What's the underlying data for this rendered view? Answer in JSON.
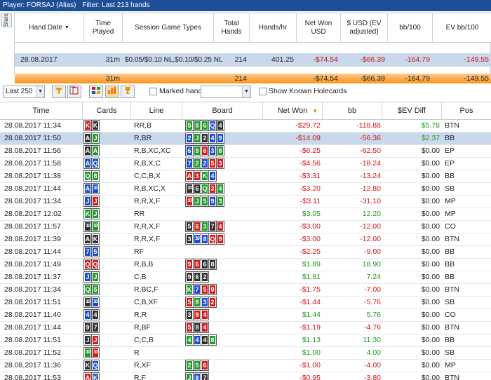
{
  "titlebar": {
    "player": "Player: FORSAJ (Alias)",
    "filter": "Filter: Last 213 hands"
  },
  "stats_tab": "Stats",
  "sessions": {
    "headers": [
      "Hand Date",
      "Time Played",
      "Session Game Types",
      "Total Hands",
      "Hands/hr",
      "Net Won USD",
      "$ USD (EV adjusted)",
      "bb/100",
      "EV bb/100"
    ],
    "row": {
      "date": "28.08.2017",
      "time": "31m",
      "games": "$0.05/$0.10 NL,$0.10/$0.25 NL",
      "hands": "214",
      "hph": "401.25",
      "net": "-$74.54",
      "ev": "-$66.39",
      "bb100": "-164.79",
      "evbb": "-149.55"
    },
    "total": {
      "time": "31m",
      "hands": "214",
      "net": "-$74.54",
      "ev": "-$66.39",
      "bb100": "-164.79",
      "evbb": "-149.55"
    }
  },
  "toolbar": {
    "limit": "Last 250",
    "marked": "Marked hands",
    "known": "Show Known Holecards"
  },
  "columns": [
    "Time",
    "Cards",
    "Line",
    "Board",
    "Net Won",
    "bb",
    "$EV Diff",
    "Pos"
  ],
  "colors": {
    "heart": "#d21b1b",
    "spade": "#2f2f2f",
    "diamond": "#1c4fd0",
    "club": "#1f9b2a",
    "accent": "#1f4e99"
  },
  "hands": [
    {
      "time": "28.08.2017 11:34",
      "cards": [
        [
          "K",
          "h"
        ],
        [
          "K",
          "s"
        ]
      ],
      "line": "RR,B",
      "board": [
        [
          "5",
          "c"
        ],
        [
          "8",
          "c"
        ],
        [
          "6",
          "c"
        ],
        [
          "Q",
          "d"
        ],
        [
          "4",
          "s"
        ]
      ],
      "net": "-$29.72",
      "bb": "-118.88",
      "ev": "$5.78",
      "pos": "BTN"
    },
    {
      "time": "28.08.2017 11:50",
      "cards": [
        [
          "A",
          "s"
        ],
        [
          "J",
          "c"
        ]
      ],
      "line": "R,BR",
      "board": [
        [
          "2",
          "d"
        ],
        [
          "J",
          "c"
        ],
        [
          "2",
          "s"
        ],
        [
          "4",
          "d"
        ],
        [
          "9",
          "d"
        ]
      ],
      "net": "-$14.09",
      "bb": "-56.36",
      "ev": "$2.37",
      "pos": "BB"
    },
    {
      "time": "28.08.2017 11:56",
      "cards": [
        [
          "A",
          "s"
        ],
        [
          "A",
          "c"
        ]
      ],
      "line": "R,B,XC,XC",
      "board": [
        [
          "6",
          "d"
        ],
        [
          "9",
          "c"
        ],
        [
          "6",
          "h"
        ],
        [
          "3",
          "d"
        ],
        [
          "8",
          "c"
        ]
      ],
      "net": "-$6.25",
      "bb": "-62.50",
      "ev": "$0.00",
      "pos": "EP"
    },
    {
      "time": "28.08.2017 11:58",
      "cards": [
        [
          "A",
          "d"
        ],
        [
          "Q",
          "d"
        ]
      ],
      "line": "R,B,X,C",
      "board": [
        [
          "7",
          "d"
        ],
        [
          "2",
          "c"
        ],
        [
          "2",
          "d"
        ],
        [
          "5",
          "h"
        ],
        [
          "3",
          "h"
        ]
      ],
      "net": "-$4.56",
      "bb": "-18.24",
      "ev": "$0.00",
      "pos": "EP"
    },
    {
      "time": "28.08.2017 11:38",
      "cards": [
        [
          "Q",
          "c"
        ],
        [
          "8",
          "c"
        ]
      ],
      "line": "C,C,B,X",
      "board": [
        [
          "A",
          "h"
        ],
        [
          "3",
          "h"
        ],
        [
          "K",
          "c"
        ],
        [
          "4",
          "d"
        ]
      ],
      "net": "-$3.31",
      "bb": "-13.24",
      "ev": "$0.00",
      "pos": "BB"
    },
    {
      "time": "28.08.2017 11:44",
      "cards": [
        [
          "A",
          "d"
        ],
        [
          "10",
          "d"
        ]
      ],
      "line": "R,B,XC,X",
      "board": [
        [
          "10",
          "s"
        ],
        [
          "6",
          "s"
        ],
        [
          "Q",
          "c"
        ],
        [
          "3",
          "h"
        ],
        [
          "4",
          "c"
        ]
      ],
      "net": "-$3.20",
      "bb": "-12.80",
      "ev": "$0.00",
      "pos": "SB"
    },
    {
      "time": "28.08.2017 11:34",
      "cards": [
        [
          "J",
          "d"
        ],
        [
          "J",
          "h"
        ]
      ],
      "line": "R,R,X,F",
      "board": [
        [
          "10",
          "h"
        ],
        [
          "J",
          "c"
        ],
        [
          "5",
          "c"
        ],
        [
          "9",
          "d"
        ],
        [
          "3",
          "c"
        ]
      ],
      "net": "-$3.11",
      "bb": "-31.10",
      "ev": "$0.00",
      "pos": "MP"
    },
    {
      "time": "28.08.2017 12:02",
      "cards": [
        [
          "K",
          "c"
        ],
        [
          "J",
          "c"
        ]
      ],
      "line": "RR",
      "board": [],
      "net": "$3.05",
      "bb": "12.20",
      "ev": "$0.00",
      "pos": "MP"
    },
    {
      "time": "28.08.2017 11:57",
      "cards": [
        [
          "10",
          "s"
        ],
        [
          "10",
          "c"
        ]
      ],
      "line": "R,R,X,F",
      "board": [
        [
          "5",
          "s"
        ],
        [
          "6",
          "h"
        ],
        [
          "3",
          "c"
        ],
        [
          "7",
          "s"
        ],
        [
          "4",
          "h"
        ]
      ],
      "net": "-$3.00",
      "bb": "-12.00",
      "ev": "$0.00",
      "pos": "CO"
    },
    {
      "time": "28.08.2017 11:39",
      "cards": [
        [
          "A",
          "s"
        ],
        [
          "K",
          "s"
        ]
      ],
      "line": "R,R,X,F",
      "board": [
        [
          "3",
          "s"
        ],
        [
          "10",
          "d"
        ],
        [
          "8",
          "d"
        ],
        [
          "Q",
          "h"
        ],
        [
          "9",
          "h"
        ]
      ],
      "net": "-$3.00",
      "bb": "-12.00",
      "ev": "$0.00",
      "pos": "BTN"
    },
    {
      "time": "28.08.2017 11:44",
      "cards": [
        [
          "7",
          "d"
        ],
        [
          "5",
          "d"
        ]
      ],
      "line": "RF",
      "board": [],
      "net": "-$2.25",
      "bb": "-9.00",
      "ev": "$0.00",
      "pos": "BB"
    },
    {
      "time": "28.08.2017 11:49",
      "cards": [
        [
          "Q",
          "h"
        ],
        [
          "Q",
          "h"
        ]
      ],
      "line": "R,B,B",
      "board": [
        [
          "9",
          "h"
        ],
        [
          "6",
          "h"
        ],
        [
          "6",
          "s"
        ],
        [
          "8",
          "s"
        ]
      ],
      "net": "$1.89",
      "bb": "18.90",
      "ev": "$0.00",
      "pos": "BB"
    },
    {
      "time": "28.08.2017 11:37",
      "cards": [
        [
          "J",
          "d"
        ],
        [
          "J",
          "c"
        ]
      ],
      "line": "C,B",
      "board": [
        [
          "9",
          "s"
        ],
        [
          "6",
          "s"
        ],
        [
          "2",
          "s"
        ]
      ],
      "net": "$1.81",
      "bb": "7.24",
      "ev": "$0.00",
      "pos": "BB"
    },
    {
      "time": "28.08.2017 11:34",
      "cards": [
        [
          "Q",
          "c"
        ],
        [
          "5",
          "c"
        ]
      ],
      "line": "R,BC,F",
      "board": [
        [
          "K",
          "c"
        ],
        [
          "7",
          "d"
        ],
        [
          "5",
          "h"
        ],
        [
          "9",
          "h"
        ]
      ],
      "net": "-$1.75",
      "bb": "-7.00",
      "ev": "$0.00",
      "pos": "BTN"
    },
    {
      "time": "28.08.2017 11:51",
      "cards": [
        [
          "10",
          "s"
        ],
        [
          "10",
          "d"
        ]
      ],
      "line": "C,B,XF",
      "board": [
        [
          "5",
          "h"
        ],
        [
          "8",
          "c"
        ],
        [
          "3",
          "d"
        ],
        [
          "2",
          "h"
        ]
      ],
      "net": "-$1.44",
      "bb": "-5.76",
      "ev": "$0.00",
      "pos": "SB"
    },
    {
      "time": "28.08.2017 11:40",
      "cards": [
        [
          "4",
          "d"
        ],
        [
          "4",
          "s"
        ]
      ],
      "line": "R,R",
      "board": [
        [
          "3",
          "s"
        ],
        [
          "9",
          "h"
        ],
        [
          "4",
          "h"
        ]
      ],
      "net": "$1.44",
      "bb": "5.76",
      "ev": "$0.00",
      "pos": "CO"
    },
    {
      "time": "28.08.2017 11:44",
      "cards": [
        [
          "9",
          "s"
        ],
        [
          "7",
          "s"
        ]
      ],
      "line": "R,BF",
      "board": [
        [
          "5",
          "h"
        ],
        [
          "8",
          "s"
        ],
        [
          "4",
          "h"
        ]
      ],
      "net": "-$1.19",
      "bb": "-4.76",
      "ev": "$0.00",
      "pos": "BTN"
    },
    {
      "time": "28.08.2017 11:51",
      "cards": [
        [
          "J",
          "s"
        ],
        [
          "J",
          "h"
        ]
      ],
      "line": "C,C,B",
      "board": [
        [
          "4",
          "c"
        ],
        [
          "4",
          "d"
        ],
        [
          "4",
          "s"
        ],
        [
          "8",
          "c"
        ]
      ],
      "net": "$1.13",
      "bb": "11.30",
      "ev": "$0.00",
      "pos": "BB"
    },
    {
      "time": "28.08.2017 11:52",
      "cards": [
        [
          "10",
          "c"
        ],
        [
          "10",
          "h"
        ]
      ],
      "line": "R",
      "board": [],
      "net": "$1.00",
      "bb": "4.00",
      "ev": "$0.00",
      "pos": "SB"
    },
    {
      "time": "28.08.2017 11:36",
      "cards": [
        [
          "K",
          "s"
        ],
        [
          "Q",
          "d"
        ]
      ],
      "line": "R,XF",
      "board": [
        [
          "2",
          "c"
        ],
        [
          "5",
          "c"
        ],
        [
          "6",
          "h"
        ]
      ],
      "net": "-$1.00",
      "bb": "-4.00",
      "ev": "$0.00",
      "pos": "MP"
    },
    {
      "time": "28.08.2017 11:53",
      "cards": [
        [
          "A",
          "h"
        ],
        [
          "K",
          "d"
        ]
      ],
      "line": "R,F",
      "board": [
        [
          "J",
          "c"
        ],
        [
          "8",
          "d"
        ],
        [
          "7",
          "s"
        ]
      ],
      "net": "-$0.95",
      "bb": "-3.80",
      "ev": "$0.00",
      "pos": "BTN"
    }
  ]
}
